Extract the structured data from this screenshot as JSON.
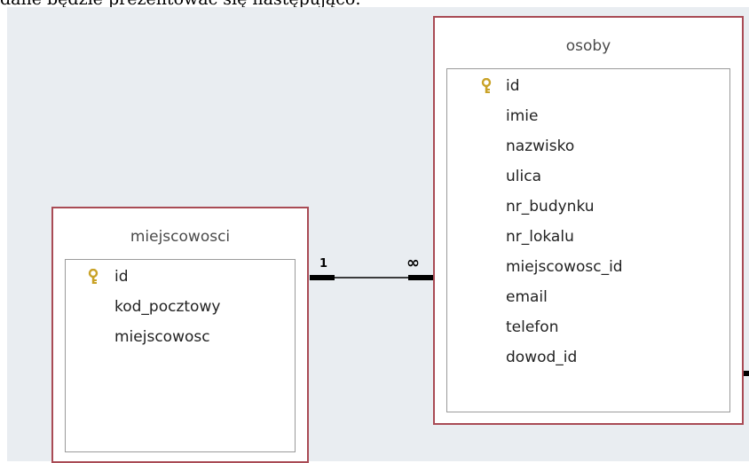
{
  "header_text": "dane będzie prezentować się następująco:",
  "relationship": {
    "one_label": "1",
    "many_label": "∞"
  },
  "tables": {
    "miejscowosci": {
      "title": "miejscowosci",
      "fields": [
        {
          "name": "id",
          "primary_key": true
        },
        {
          "name": "kod_pocztowy",
          "primary_key": false
        },
        {
          "name": "miejscowosc",
          "primary_key": false
        }
      ]
    },
    "osoby": {
      "title": "osoby",
      "fields": [
        {
          "name": "id",
          "primary_key": true
        },
        {
          "name": "imie",
          "primary_key": false
        },
        {
          "name": "nazwisko",
          "primary_key": false
        },
        {
          "name": "ulica",
          "primary_key": false
        },
        {
          "name": "nr_budynku",
          "primary_key": false
        },
        {
          "name": "nr_lokalu",
          "primary_key": false
        },
        {
          "name": "miejscowosc_id",
          "primary_key": false
        },
        {
          "name": "email",
          "primary_key": false
        },
        {
          "name": "telefon",
          "primary_key": false
        },
        {
          "name": "dowod_id",
          "primary_key": false
        }
      ]
    }
  },
  "colors": {
    "table_border": "#a94b55",
    "canvas_bg": "#e9edf1",
    "key_icon": "#c9a227"
  }
}
